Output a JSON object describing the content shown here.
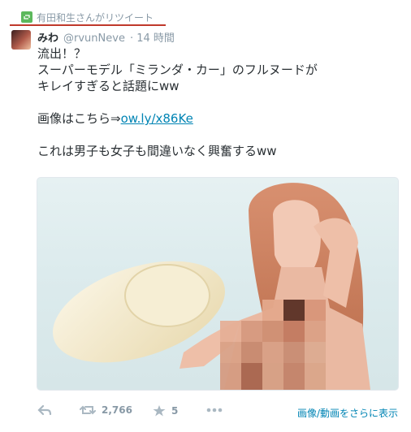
{
  "retweet": {
    "text": "有田和生さんがリツイート"
  },
  "tweet": {
    "name": "みわ",
    "handle": "@rvunNeve",
    "time": "· 14 時間",
    "lines": [
      "流出！？",
      "スーパーモデル「ミランダ・カー」のフルヌードが",
      "キレイすぎると話題にww",
      "",
      "画像はこちら⇒",
      "",
      "これは男子も女子も間違いなく興奮するww"
    ],
    "link": "ow.ly/x86Ke"
  },
  "actions": {
    "retweet_count": "2,766",
    "favorite_count": "5",
    "more_media": "画像/動画をさらに表示"
  },
  "icons": [
    "retweet-badge-icon",
    "reply-icon",
    "retweet-icon",
    "star-icon",
    "more-icon"
  ],
  "colors": {
    "link": "#0084b4",
    "muted": "#8899a6",
    "retweet_badge": "#5cb85c",
    "rule": "#c0392b"
  }
}
